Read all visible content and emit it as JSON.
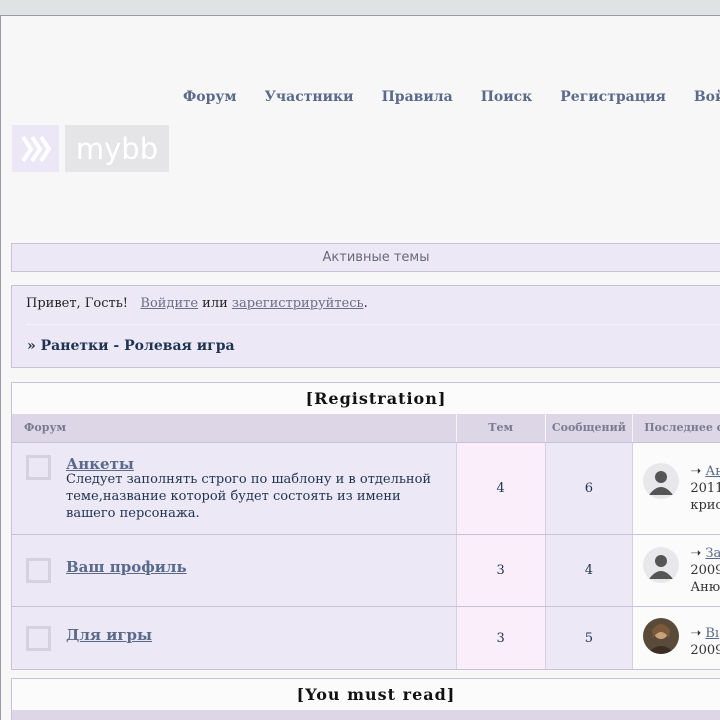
{
  "nav": {
    "items": [
      "Форум",
      "Участники",
      "Правила",
      "Поиск",
      "Регистрация",
      "Войти"
    ]
  },
  "logo": {
    "mark": "⟫⟫",
    "word": "mybb"
  },
  "active_topics": "Активные темы",
  "welcome": {
    "greeting": "Привет, Гость!",
    "login_link": "Войдите",
    "or": "или",
    "register_link": "зарегистрируйтесь",
    "period": ".",
    "breadcrumb": "» Ранетки - Ролевая игра"
  },
  "categories": [
    {
      "title": "[Registration]",
      "headers": {
        "forum": "Форум",
        "topics": "Тем",
        "posts": "Сообщений",
        "last": "Последнее с"
      },
      "forums": [
        {
          "name": "Анкеты",
          "description": "Следует заполнять строго по шаблону и в отдельной теме,название которой будет состоять из имени вашего персонажа.",
          "topics": "4",
          "posts": "6",
          "last_arrow": "➝",
          "last_link": "Ан",
          "last_line2": "2011",
          "last_line3": "крис"
        },
        {
          "name": "Ваш профиль",
          "description": "",
          "topics": "3",
          "posts": "4",
          "last_arrow": "➝",
          "last_link": "За",
          "last_line2": "2009",
          "last_line3": "Аню"
        },
        {
          "name": "Для игры",
          "description": "",
          "topics": "3",
          "posts": "5",
          "last_arrow": "➝",
          "last_link": "Вı",
          "last_line2": "2009",
          "last_line3": ""
        }
      ]
    },
    {
      "title": "[You must read]"
    }
  ]
}
